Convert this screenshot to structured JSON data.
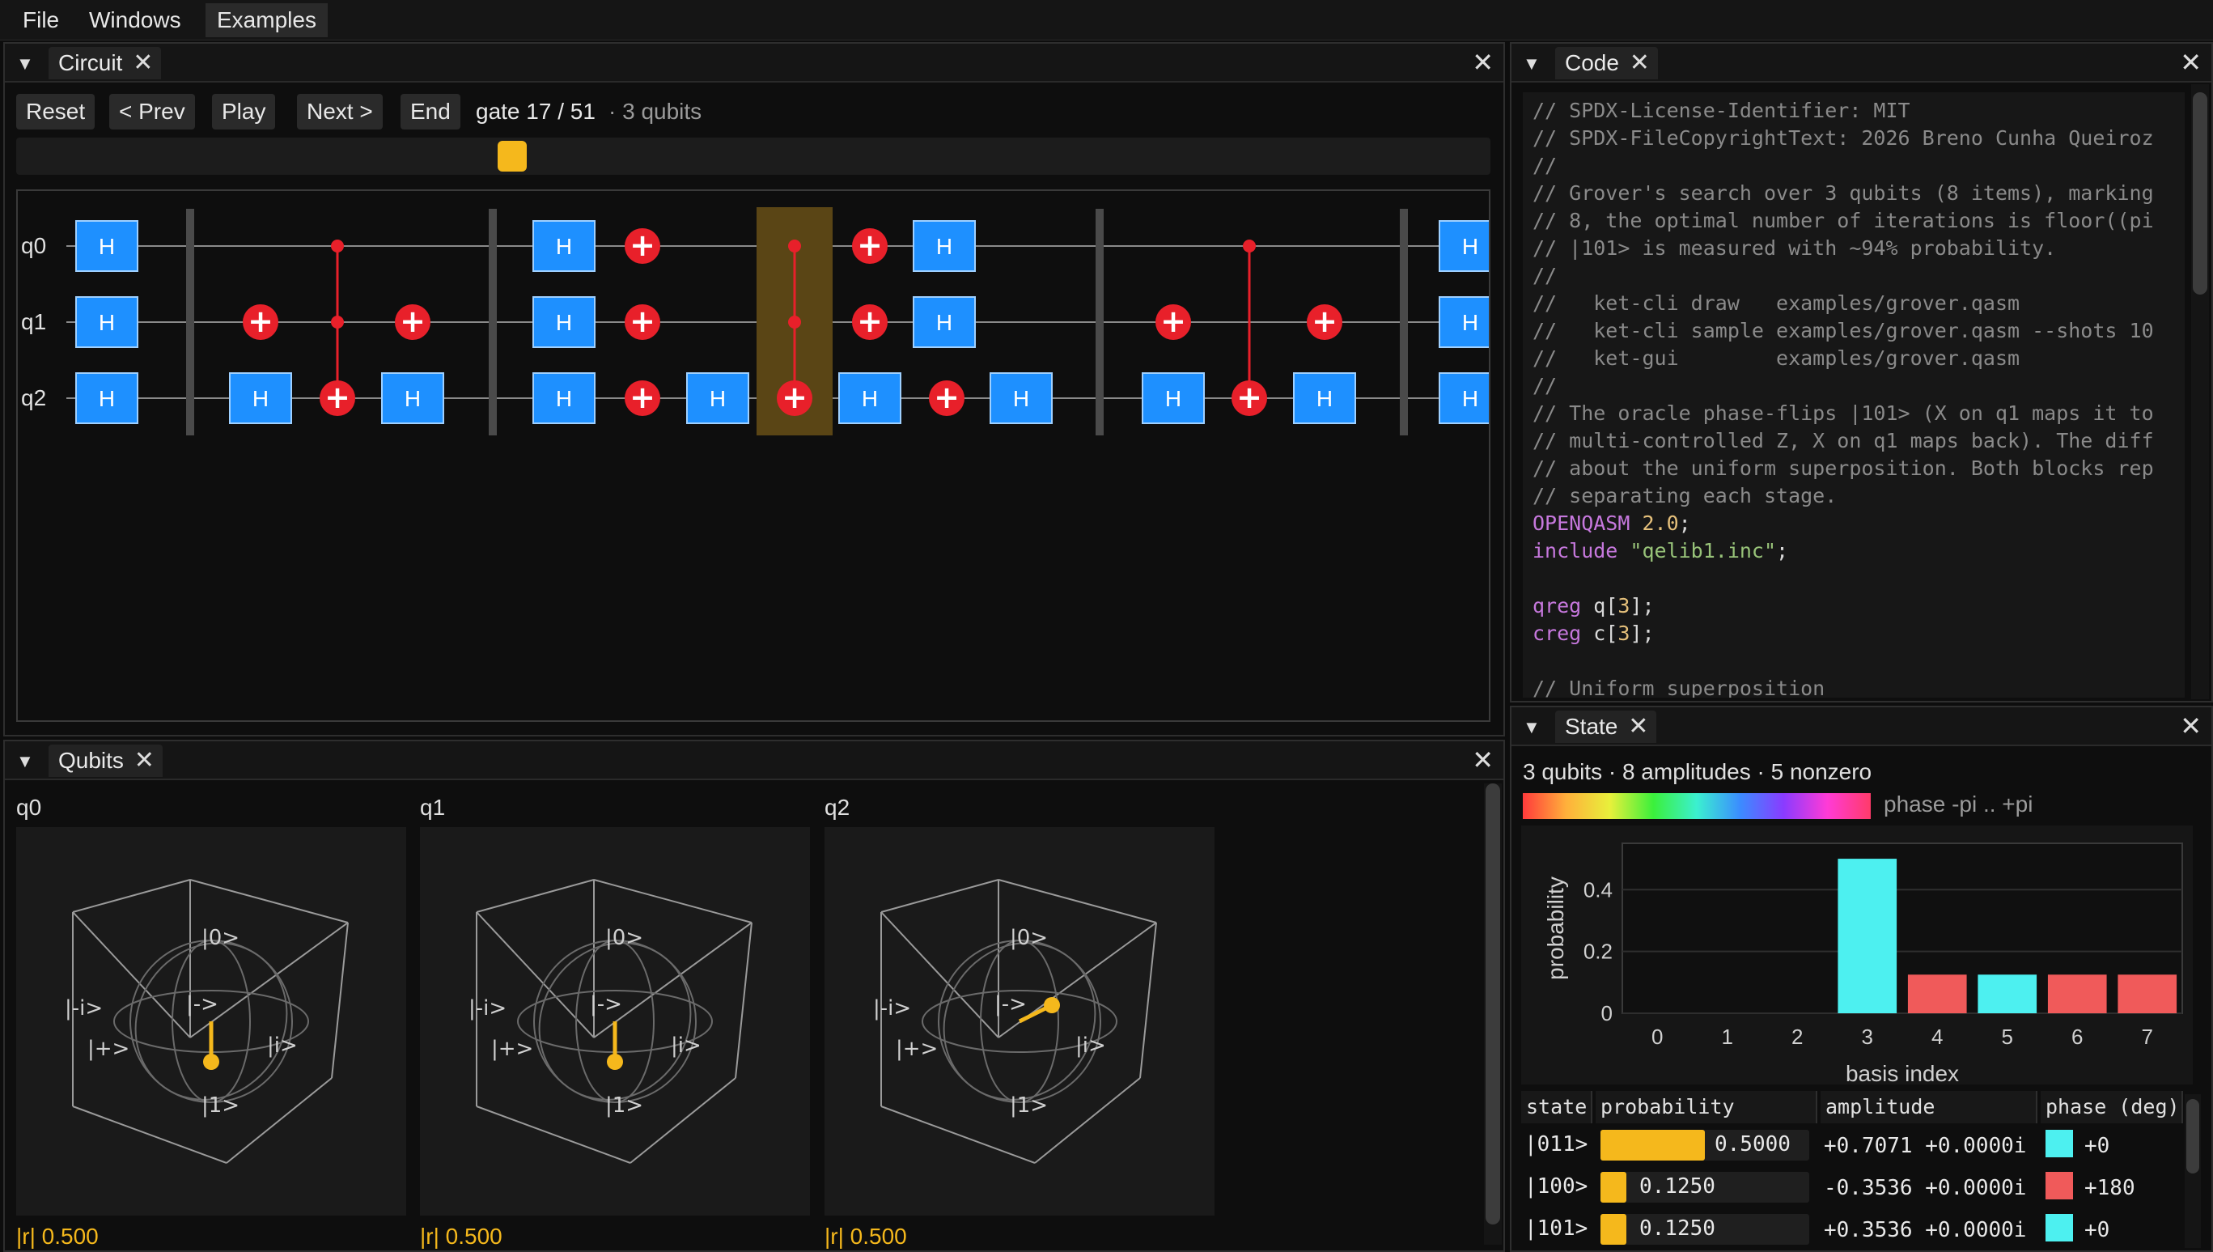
{
  "menu": {
    "file": "File",
    "windows": "Windows",
    "examples": "Examples"
  },
  "circuit": {
    "tab": "Circuit",
    "buttons": {
      "reset": "Reset",
      "prev": "< Prev",
      "play": "Play",
      "next": "Next >",
      "end": "End"
    },
    "gate_status": "gate 17 / 51",
    "qubits_status": "· 3 qubits",
    "slider_progress": 0.333,
    "wires": [
      "q0",
      "q1",
      "q2"
    ],
    "h_label": "H",
    "plus_symbol": "+"
  },
  "code": {
    "tab": "Code",
    "lines": [
      [
        [
          "c-com",
          "// SPDX-License-Identifier: MIT"
        ]
      ],
      [
        [
          "c-com",
          "// SPDX-FileCopyrightText: 2026 Breno Cunha Queiroz"
        ]
      ],
      [
        [
          "c-com",
          "//"
        ]
      ],
      [
        [
          "c-com",
          "// Grover's search over 3 qubits (8 items), marking"
        ]
      ],
      [
        [
          "c-com",
          "// 8, the optimal number of iterations is floor((pi"
        ]
      ],
      [
        [
          "c-com",
          "// |101> is measured with ~94% probability."
        ]
      ],
      [
        [
          "c-com",
          "//"
        ]
      ],
      [
        [
          "c-com",
          "//   ket-cli draw   examples/grover.qasm"
        ]
      ],
      [
        [
          "c-com",
          "//   ket-cli sample examples/grover.qasm --shots 10"
        ]
      ],
      [
        [
          "c-com",
          "//   ket-gui        examples/grover.qasm"
        ]
      ],
      [
        [
          "c-com",
          "//"
        ]
      ],
      [
        [
          "c-com",
          "// The oracle phase-flips |101> (X on q1 maps it to"
        ]
      ],
      [
        [
          "c-com",
          "// multi-controlled Z, X on q1 maps back). The diff"
        ]
      ],
      [
        [
          "c-com",
          "// about the uniform superposition. Both blocks rep"
        ]
      ],
      [
        [
          "c-com",
          "// separating each stage."
        ]
      ],
      [
        [
          "c-kw",
          "OPENQASM "
        ],
        [
          "c-num",
          "2.0"
        ],
        [
          "c-def",
          ";"
        ]
      ],
      [
        [
          "c-kw",
          "include "
        ],
        [
          "c-str",
          "\"qelib1.inc\""
        ],
        [
          "c-def",
          ";"
        ]
      ],
      [
        [
          "c-def",
          ""
        ]
      ],
      [
        [
          "c-kw",
          "qreg "
        ],
        [
          "c-def",
          "q["
        ],
        [
          "c-num",
          "3"
        ],
        [
          "c-def",
          "];"
        ]
      ],
      [
        [
          "c-kw",
          "creg "
        ],
        [
          "c-def",
          "c["
        ],
        [
          "c-num",
          "3"
        ],
        [
          "c-def",
          "];"
        ]
      ],
      [
        [
          "c-def",
          ""
        ]
      ],
      [
        [
          "c-com",
          "// Uniform superposition"
        ]
      ]
    ]
  },
  "qubits": {
    "tab": "Qubits",
    "spheres": [
      {
        "name": "q0",
        "r_label": "|r| 0.500"
      },
      {
        "name": "q1",
        "r_label": "|r| 0.500"
      },
      {
        "name": "q2",
        "r_label": "|r| 0.500"
      }
    ],
    "axis_labels": {
      "zero": "|0>",
      "one": "|1>",
      "plus": "|+>",
      "minus": "|->",
      "i": "|i>",
      "mi": "|-i>"
    }
  },
  "state": {
    "tab": "State",
    "summary": "3 qubits · 8 amplitudes · 5 nonzero",
    "phase_label": "phase -pi .. +pi",
    "table_headers": {
      "state": "state",
      "probability": "probability",
      "amplitude": "amplitude",
      "phase": "phase (deg)"
    },
    "rows": [
      {
        "state": "|011>",
        "prob": 0.5,
        "prob_text": "0.5000",
        "amplitude": "+0.7071 +0.0000i",
        "phase": "+0",
        "color": "#4df0f0"
      },
      {
        "state": "|100>",
        "prob": 0.125,
        "prob_text": "0.1250",
        "amplitude": "-0.3536 +0.0000i",
        "phase": "+180",
        "color": "#f05a5a"
      },
      {
        "state": "|101>",
        "prob": 0.125,
        "prob_text": "0.1250",
        "amplitude": "+0.3536 +0.0000i",
        "phase": "+0",
        "color": "#4df0f0"
      }
    ]
  },
  "chart_data": {
    "type": "bar",
    "categories": [
      "0",
      "1",
      "2",
      "3",
      "4",
      "5",
      "6",
      "7"
    ],
    "values": [
      0,
      0,
      0,
      0.5,
      0.125,
      0.125,
      0.125,
      0.125
    ],
    "colors": [
      "#4df0f0",
      "#4df0f0",
      "#4df0f0",
      "#4df0f0",
      "#f05a5a",
      "#4df0f0",
      "#f05a5a",
      "#f05a5a"
    ],
    "xlabel": "basis index",
    "ylabel": "probability",
    "ylim": [
      0,
      0.55
    ],
    "yticks": [
      "0",
      "0.2",
      "0.4"
    ],
    "ytick_values": [
      0,
      0.2,
      0.4
    ]
  },
  "colors": {
    "accent": "#f5b81c",
    "gate_blue": "#1e90ff",
    "gate_red": "#e8202a"
  }
}
